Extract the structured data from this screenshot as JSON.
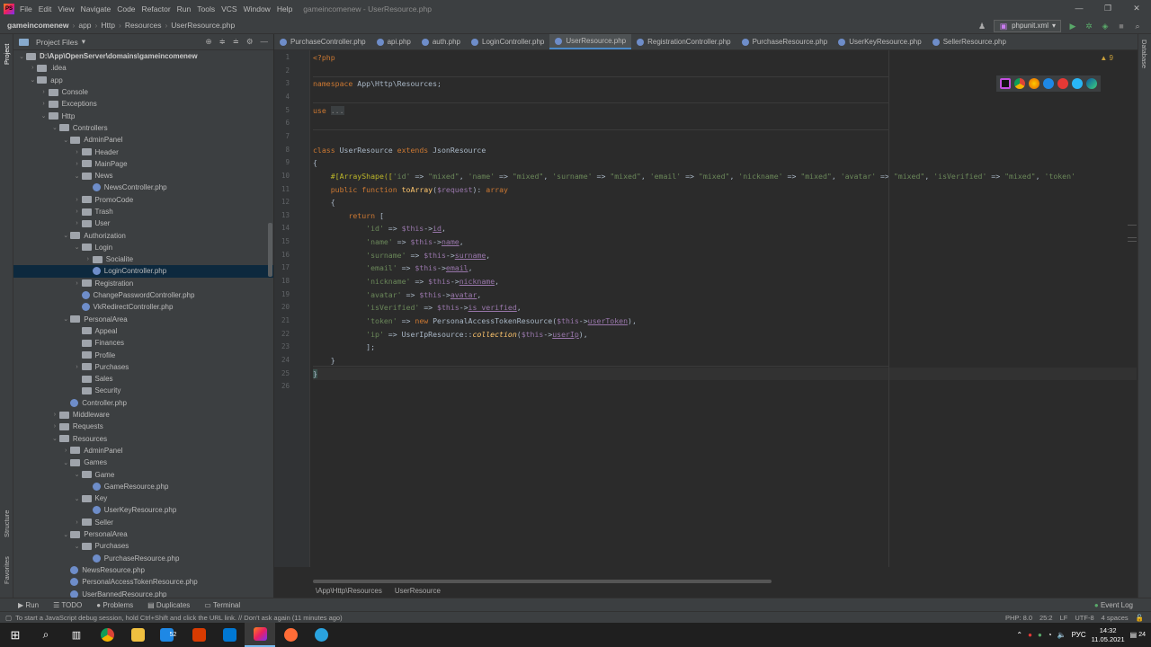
{
  "window": {
    "menu": [
      "File",
      "Edit",
      "View",
      "Navigate",
      "Code",
      "Refactor",
      "Run",
      "Tools",
      "VCS",
      "Window",
      "Help"
    ],
    "title": "gameincomenew - UserResource.php"
  },
  "navbar": {
    "breadcrumb": [
      "gameincomenew",
      "app",
      "Http",
      "Resources",
      "UserResource.php"
    ],
    "run_config": "phpunit.xml"
  },
  "project_panel": {
    "title": "Project Files",
    "left_tabs": [
      "Project",
      "Structure",
      "Favorites"
    ],
    "tree": [
      {
        "label": "D:\\App\\OpenServer\\domains\\gameincomenew",
        "depth": 0,
        "type": "folder",
        "open": true,
        "bold": true
      },
      {
        "label": ".idea",
        "depth": 1,
        "type": "folder",
        "open": false
      },
      {
        "label": "app",
        "depth": 1,
        "type": "folder",
        "open": true
      },
      {
        "label": "Console",
        "depth": 2,
        "type": "folder",
        "open": false
      },
      {
        "label": "Exceptions",
        "depth": 2,
        "type": "folder",
        "open": false
      },
      {
        "label": "Http",
        "depth": 2,
        "type": "folder",
        "open": true
      },
      {
        "label": "Controllers",
        "depth": 3,
        "type": "folder",
        "open": true
      },
      {
        "label": "AdminPanel",
        "depth": 4,
        "type": "folder",
        "open": true
      },
      {
        "label": "Header",
        "depth": 5,
        "type": "folder",
        "open": false
      },
      {
        "label": "MainPage",
        "depth": 5,
        "type": "folder",
        "open": false
      },
      {
        "label": "News",
        "depth": 5,
        "type": "folder",
        "open": true
      },
      {
        "label": "NewsController.php",
        "depth": 6,
        "type": "file"
      },
      {
        "label": "PromoCode",
        "depth": 5,
        "type": "folder",
        "open": false
      },
      {
        "label": "Trash",
        "depth": 5,
        "type": "folder",
        "open": false
      },
      {
        "label": "User",
        "depth": 5,
        "type": "folder",
        "open": false
      },
      {
        "label": "Authorization",
        "depth": 4,
        "type": "folder",
        "open": true
      },
      {
        "label": "Login",
        "depth": 5,
        "type": "folder",
        "open": true
      },
      {
        "label": "Socialite",
        "depth": 6,
        "type": "folder",
        "open": false
      },
      {
        "label": "LoginController.php",
        "depth": 6,
        "type": "file",
        "selected": true
      },
      {
        "label": "Registration",
        "depth": 5,
        "type": "folder",
        "open": false
      },
      {
        "label": "ChangePasswordController.php",
        "depth": 5,
        "type": "file"
      },
      {
        "label": "VkRedirectController.php",
        "depth": 5,
        "type": "file"
      },
      {
        "label": "PersonalArea",
        "depth": 4,
        "type": "folder",
        "open": true
      },
      {
        "label": "Appeal",
        "depth": 5,
        "type": "folder",
        "leaf": true
      },
      {
        "label": "Finances",
        "depth": 5,
        "type": "folder",
        "leaf": true
      },
      {
        "label": "Profile",
        "depth": 5,
        "type": "folder",
        "leaf": true
      },
      {
        "label": "Purchases",
        "depth": 5,
        "type": "folder",
        "open": false
      },
      {
        "label": "Sales",
        "depth": 5,
        "type": "folder",
        "leaf": true
      },
      {
        "label": "Security",
        "depth": 5,
        "type": "folder",
        "leaf": true
      },
      {
        "label": "Controller.php",
        "depth": 4,
        "type": "file"
      },
      {
        "label": "Middleware",
        "depth": 3,
        "type": "folder",
        "open": false
      },
      {
        "label": "Requests",
        "depth": 3,
        "type": "folder",
        "open": false
      },
      {
        "label": "Resources",
        "depth": 3,
        "type": "folder",
        "open": true
      },
      {
        "label": "AdminPanel",
        "depth": 4,
        "type": "folder",
        "open": false
      },
      {
        "label": "Games",
        "depth": 4,
        "type": "folder",
        "open": true
      },
      {
        "label": "Game",
        "depth": 5,
        "type": "folder",
        "open": true
      },
      {
        "label": "GameResource.php",
        "depth": 6,
        "type": "file"
      },
      {
        "label": "Key",
        "depth": 5,
        "type": "folder",
        "open": true
      },
      {
        "label": "UserKeyResource.php",
        "depth": 6,
        "type": "file"
      },
      {
        "label": "Seller",
        "depth": 5,
        "type": "folder",
        "open": false
      },
      {
        "label": "PersonalArea",
        "depth": 4,
        "type": "folder",
        "open": true
      },
      {
        "label": "Purchases",
        "depth": 5,
        "type": "folder",
        "open": true
      },
      {
        "label": "PurchaseResource.php",
        "depth": 6,
        "type": "file"
      },
      {
        "label": "NewsResource.php",
        "depth": 4,
        "type": "file"
      },
      {
        "label": "PersonalAccessTokenResource.php",
        "depth": 4,
        "type": "file"
      },
      {
        "label": "UserBannedResource.php",
        "depth": 4,
        "type": "file"
      }
    ]
  },
  "editor": {
    "tabs": [
      {
        "label": "PurchaseController.php",
        "active": false
      },
      {
        "label": "api.php",
        "active": false
      },
      {
        "label": "auth.php",
        "active": false
      },
      {
        "label": "LoginController.php",
        "active": false
      },
      {
        "label": "UserResource.php",
        "active": true
      },
      {
        "label": "RegistrationController.php",
        "active": false
      },
      {
        "label": "PurchaseResource.php",
        "active": false
      },
      {
        "label": "UserKeyResource.php",
        "active": false
      },
      {
        "label": "SellerResource.php",
        "active": false
      }
    ],
    "warnings": "▲ 9",
    "current_line": 25,
    "lines": [
      {
        "n": "1",
        "html": "<span class='kw'>&lt;?php</span>"
      },
      {
        "n": "2",
        "html": ""
      },
      {
        "n": "3",
        "html": "<span class='kw'>namespace</span> App\\Http\\Resources;"
      },
      {
        "n": "4",
        "html": ""
      },
      {
        "n": "5",
        "html": "<span class='kw'>use</span> <span style='background:#3b3f41;color:#888'>...</span>"
      },
      {
        "n": "6",
        "html": ""
      },
      {
        "n": "7",
        "html": ""
      },
      {
        "n": "8",
        "html": "<span class='kw'>class</span> UserResource <span class='kw'>extends</span> JsonResource"
      },
      {
        "n": "9",
        "html": "{"
      },
      {
        "n": "10",
        "html": "    <span class='attr'>#[ArrayShape([</span><span class='str'>'id'</span> =&gt; <span class='str'>\"mixed\"</span>, <span class='str'>'name'</span> =&gt; <span class='str'>\"mixed\"</span>, <span class='str'>'surname'</span> =&gt; <span class='str'>\"mixed\"</span>, <span class='str'>'email'</span> =&gt; <span class='str'>\"mixed\"</span>, <span class='str'>'nickname'</span> =&gt; <span class='str'>\"mixed\"</span>, <span class='str'>'avatar'</span> =&gt; <span class='str'>\"mixed\"</span>, <span class='str'>'isVerified'</span> =&gt; <span class='str'>\"mixed\"</span>, <span class='str'>'token'</span>"
      },
      {
        "n": "11",
        "html": "    <span class='kw'>public function</span> <span class='fn'>toArray</span>(<span class='var'>$request</span>): <span class='kw'>array</span>"
      },
      {
        "n": "12",
        "html": "    {"
      },
      {
        "n": "13",
        "html": "        <span class='kw'>return</span> ["
      },
      {
        "n": "14",
        "html": "            <span class='str'>'id'</span> =&gt; <span class='var'>$this</span>-&gt;<span class='fld'>id</span>,"
      },
      {
        "n": "15",
        "html": "            <span class='str'>'name'</span> =&gt; <span class='var'>$this</span>-&gt;<span class='fld'>name</span>,"
      },
      {
        "n": "16",
        "html": "            <span class='str'>'surname'</span> =&gt; <span class='var'>$this</span>-&gt;<span class='fld'>surname</span>,"
      },
      {
        "n": "17",
        "html": "            <span class='str'>'email'</span> =&gt; <span class='var'>$this</span>-&gt;<span class='fld'>email</span>,"
      },
      {
        "n": "18",
        "html": "            <span class='str'>'nickname'</span> =&gt; <span class='var'>$this</span>-&gt;<span class='fld'>nickname</span>,"
      },
      {
        "n": "19",
        "html": "            <span class='str'>'avatar'</span> =&gt; <span class='var'>$this</span>-&gt;<span class='fld'>avatar</span>,"
      },
      {
        "n": "20",
        "html": "            <span class='str'>'isVerified'</span> =&gt; <span class='var'>$this</span>-&gt;<span class='fld'>is_verified</span>,"
      },
      {
        "n": "21",
        "html": "            <span class='str'>'token'</span> =&gt; <span class='kw'>new</span> PersonalAccessTokenResource(<span class='var'>$this</span>-&gt;<span class='fld'>userToken</span>),"
      },
      {
        "n": "22",
        "html": "            <span class='str'>'ip'</span> =&gt; UserIpResource::<span class='fn' style='font-style:italic'>collection</span>(<span class='var'>$this</span>-&gt;<span class='fld'>userIp</span>),"
      },
      {
        "n": "23",
        "html": "            ];"
      },
      {
        "n": "24",
        "html": "    }"
      },
      {
        "n": "25",
        "html": "<span style='background:#3b514d'>}</span>"
      },
      {
        "n": "26",
        "html": ""
      }
    ],
    "breadcrumb": [
      "\\App\\Http\\Resources",
      "UserResource"
    ],
    "right_tab": "Database"
  },
  "bottom_tools": [
    "Run",
    "TODO",
    "Problems",
    "Duplicates",
    "Terminal"
  ],
  "event_log": "Event Log",
  "status": {
    "message": "To start a JavaScript debug session, hold Ctrl+Shift and click the URL link. // Don't ask again (11 minutes ago)",
    "php": "PHP: 8.0",
    "position": "25:2",
    "line_sep": "LF",
    "encoding": "UTF-8",
    "indent": "4 spaces"
  },
  "taskbar": {
    "badge": "52",
    "lang": "РУС",
    "time": "14:32",
    "date": "11.05.2021",
    "notif": "24"
  }
}
